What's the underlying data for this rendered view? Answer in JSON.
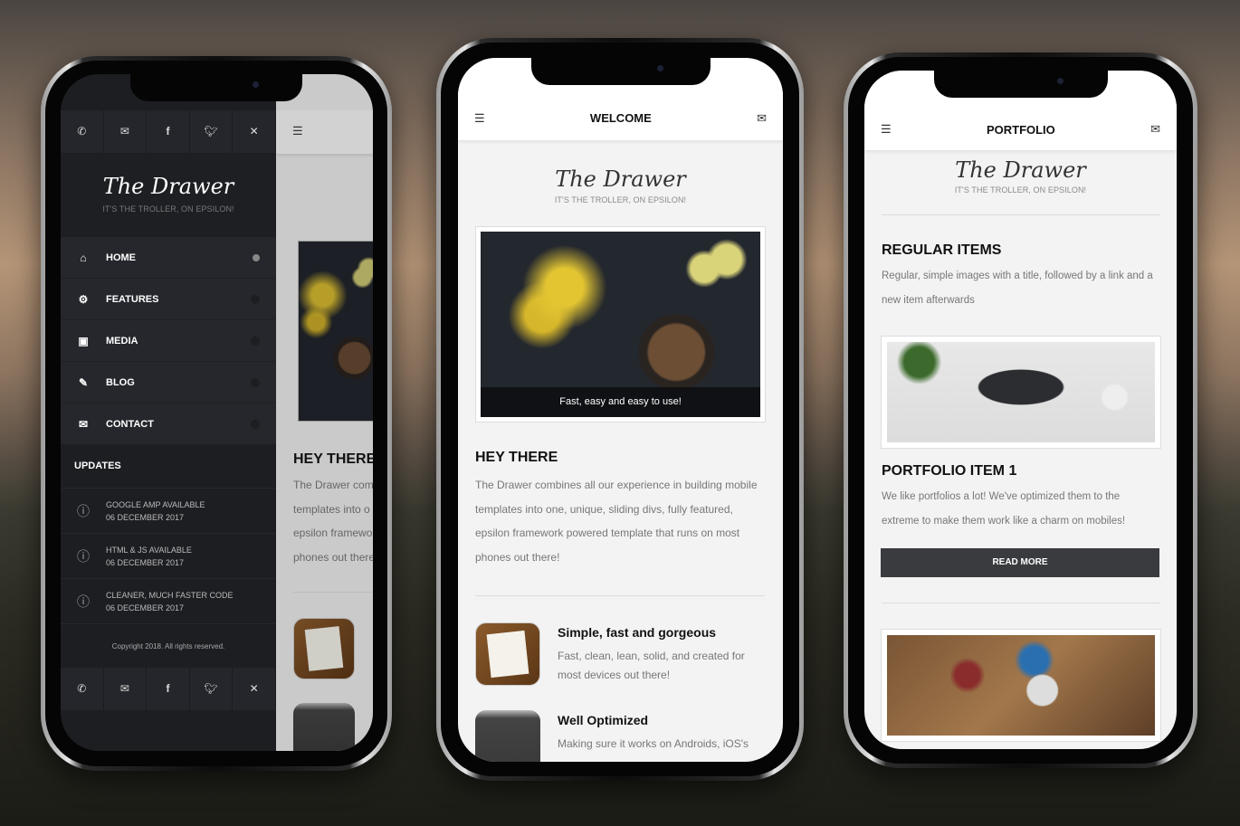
{
  "brand": {
    "logo": "The Drawer",
    "tagline": "IT'S THE TROLLER, ON EPSILON!"
  },
  "left": {
    "social": [
      "phone-icon",
      "mail-icon",
      "facebook-icon",
      "twitter-icon",
      "close-icon"
    ],
    "menu": [
      {
        "label": "HOME",
        "icon": "home-icon",
        "active": true
      },
      {
        "label": "FEATURES",
        "icon": "gear-icon"
      },
      {
        "label": "MEDIA",
        "icon": "image-icon"
      },
      {
        "label": "BLOG",
        "icon": "pencil-icon"
      },
      {
        "label": "CONTACT",
        "icon": "mail-icon"
      }
    ],
    "updates_title": "UPDATES",
    "updates": [
      {
        "title": "GOOGLE AMP AVAILABLE",
        "date": "06 DECEMBER 2017"
      },
      {
        "title": "HTML & JS AVAILABLE",
        "date": "06 DECEMBER 2017"
      },
      {
        "title": "CLEANER, MUCH FASTER CODE",
        "date": "06 DECEMBER 2017"
      }
    ],
    "copyright": "Copyright 2018. All rights reserved.",
    "peek": {
      "heading": "HEY THERE",
      "lines": [
        "The Drawer com",
        "templates into o",
        "epsilon framewo",
        "phones out there"
      ]
    }
  },
  "middle": {
    "title": "WELCOME",
    "caption": "Fast, easy and easy to use!",
    "heading": "HEY THERE",
    "paragraph": [
      "The Drawer combines all our experience in building mobile",
      "templates into one, unique, sliding divs, fully featured,",
      "epsilon framework powered template that runs on most",
      "phones out there!"
    ],
    "features": [
      {
        "title": "Simple, fast and gorgeous",
        "lines": [
          "Fast, clean, lean, solid, and created for",
          "most devices out there!"
        ]
      },
      {
        "title": "Well Optimized",
        "lines": [
          "Making sure it works on Androids, iOS's"
        ]
      }
    ]
  },
  "right": {
    "title": "PORTFOLIO",
    "heading": "REGULAR ITEMS",
    "intro": [
      "Regular, simple images with a title, followed by a link and a",
      "new item afterwards"
    ],
    "item_title": "PORTFOLIO ITEM 1",
    "item_text": [
      "We like portfolios a lot! We've optimized them to the",
      "extreme to make them work like a charm on mobiles!"
    ],
    "button": "READ MORE"
  },
  "colors": {
    "drawer": "#25272c",
    "drawer_dark": "#1d1e22",
    "button": "#3a3b3f",
    "page": "#f3f3f3"
  }
}
